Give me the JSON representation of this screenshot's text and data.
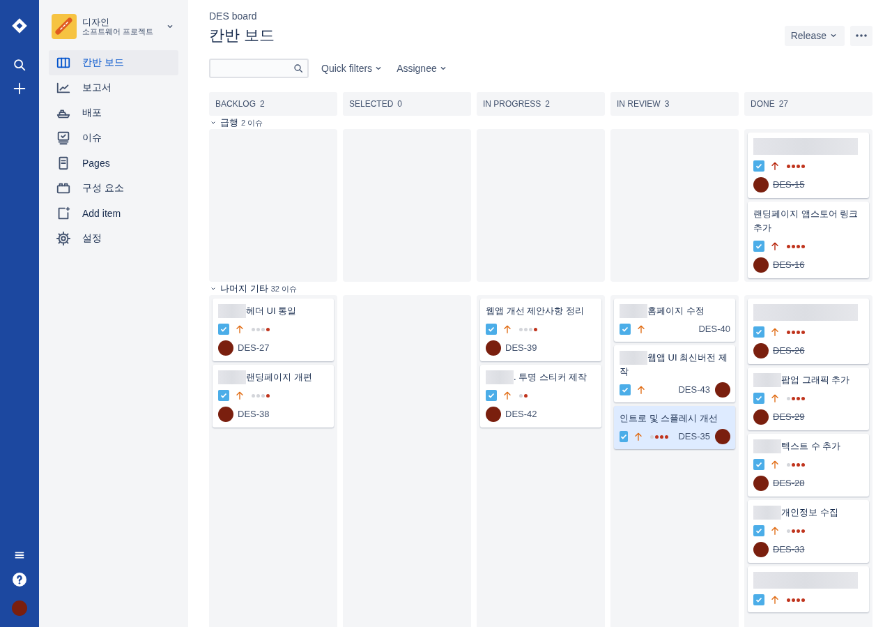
{
  "project": {
    "name": "디자인",
    "subtitle": "소프트웨어 프로젝트"
  },
  "sidebar": {
    "items": [
      {
        "label": "칸반 보드",
        "selected": true
      },
      {
        "label": "보고서",
        "selected": false
      },
      {
        "label": "배포",
        "selected": false
      },
      {
        "label": "이슈",
        "selected": false
      },
      {
        "label": "Pages",
        "selected": false
      },
      {
        "label": "구성 요소",
        "selected": false
      },
      {
        "label": "Add item",
        "selected": false
      },
      {
        "label": "설정",
        "selected": false
      }
    ]
  },
  "header": {
    "breadcrumb": "DES board",
    "title": "칸반 보드",
    "buttons": [
      "Release"
    ]
  },
  "filters": {
    "quick_filters": "Quick filters",
    "assignee": "Assignee"
  },
  "columns": [
    {
      "name": "BACKLOG",
      "count": "2"
    },
    {
      "name": "SELECTED",
      "count": "0"
    },
    {
      "name": "IN PROGRESS",
      "count": "2"
    },
    {
      "name": "IN REVIEW",
      "count": "3"
    },
    {
      "name": "DONE",
      "count": "27"
    }
  ],
  "swimlanes": [
    {
      "title": "급행",
      "count": "2 이슈",
      "expanded": true,
      "cells": [
        [],
        [],
        [],
        [],
        [
          {
            "kind": "stacked",
            "blurred": true,
            "priority_highest": true,
            "estimate_dots": [
              true,
              true,
              true,
              true
            ],
            "key": "DES-15",
            "avatar": true,
            "done": true,
            "selected": false
          },
          {
            "kind": "stacked",
            "title": "랜딩페이지 앱스토어 링크 추가",
            "blurred": false,
            "priority_highest": true,
            "estimate_dots": [
              true,
              true,
              true,
              true
            ],
            "key": "DES-16",
            "avatar": true,
            "done": true,
            "selected": false
          }
        ]
      ]
    },
    {
      "title": "나머지 기타",
      "count": "32 이슈",
      "expanded": true,
      "cells": [
        [
          {
            "kind": "stacked",
            "title": "헤더 UI 통일",
            "blurred": true,
            "priority_highest": false,
            "estimate_dots": [
              false,
              false,
              false,
              true
            ],
            "key": "DES-27",
            "avatar": true,
            "done": false,
            "selected": false
          },
          {
            "kind": "stacked",
            "title": "랜딩페이지 개편",
            "blurred": true,
            "priority_highest": false,
            "estimate_dots": [
              false,
              false,
              false,
              true
            ],
            "key": "DES-38",
            "avatar": true,
            "done": false,
            "selected": false
          }
        ],
        [],
        [
          {
            "kind": "stacked",
            "title": "웹앱 개선 제안사항 정리",
            "blurred": false,
            "priority_highest": false,
            "estimate_dots": [
              false,
              false,
              false,
              true
            ],
            "key": "DES-39",
            "avatar": true,
            "done": false,
            "selected": false
          },
          {
            "kind": "stacked",
            "title": ". 투명 스티커 제작",
            "blurred": true,
            "priority_highest": false,
            "estimate_dots": [
              false,
              true
            ],
            "key": "DES-42",
            "avatar": true,
            "done": false,
            "selected": false
          }
        ],
        [
          {
            "kind": "compact",
            "title": "홈페이지 수정",
            "blurred": true,
            "priority_highest": false,
            "key": "DES-40",
            "avatar": false,
            "done": false,
            "selected": false
          },
          {
            "kind": "compact",
            "title": "웹앱 UI 최신버전 제작",
            "blurred": true,
            "priority_highest": false,
            "key": "DES-43",
            "avatar": true,
            "done": false,
            "selected": false
          },
          {
            "kind": "compact",
            "title": "인트로 및 스플레시 개선",
            "blurred": false,
            "priority_highest": false,
            "estimate_dots": [
              false,
              true,
              true,
              true
            ],
            "key": "DES-35",
            "avatar": true,
            "done": false,
            "selected": true
          }
        ],
        [
          {
            "kind": "stacked",
            "blurred": true,
            "priority_highest": false,
            "estimate_dots": [
              true,
              true,
              true,
              true
            ],
            "key": "DES-26",
            "avatar": true,
            "done": true,
            "selected": false
          },
          {
            "kind": "stacked",
            "title": "팝업 그래픽 추가",
            "blurred": true,
            "priority_highest": false,
            "estimate_dots": [
              false,
              true,
              true,
              true
            ],
            "key": "DES-29",
            "avatar": true,
            "done": true,
            "selected": false
          },
          {
            "kind": "stacked",
            "title": "텍스트 수 추가",
            "blurred": true,
            "priority_highest": false,
            "estimate_dots": [
              false,
              true,
              true,
              true
            ],
            "key": "DES-28",
            "avatar": true,
            "done": true,
            "selected": false
          },
          {
            "kind": "stacked",
            "title": "개인정보 수집",
            "blurred": true,
            "priority_highest": false,
            "estimate_dots": [
              false,
              true,
              true,
              true
            ],
            "key": "DES-33",
            "avatar": true,
            "done": true,
            "selected": false
          },
          {
            "kind": "stacked",
            "blurred": true,
            "priority_highest": false,
            "estimate_dots": [
              true,
              true,
              true,
              true
            ],
            "selected": false
          }
        ]
      ]
    }
  ]
}
